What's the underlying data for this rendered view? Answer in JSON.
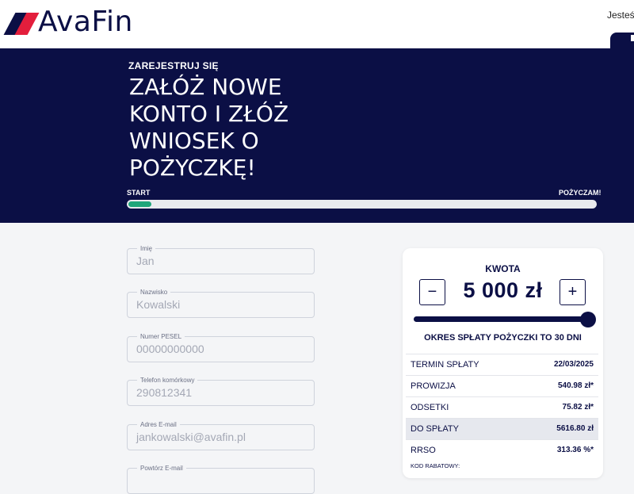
{
  "header": {
    "brand": "AvaFin",
    "account_text": "Jesteś"
  },
  "hero": {
    "subtitle": "ZAREJESTRUJ SIĘ",
    "title": "ZAŁÓŻ NOWE KONTO I ZŁÓŻ WNIOSEK O POŻYCZKĘ!",
    "progress_start": "START",
    "progress_end": "POŻYCZAM!",
    "progress_fraction": 0.05
  },
  "form": {
    "fields": [
      {
        "label": "Imię",
        "value": "Jan"
      },
      {
        "label": "Nazwisko",
        "value": "Kowalski"
      },
      {
        "label": "Numer PESEL",
        "value": "00000000000"
      },
      {
        "label": "Telefon komórkowy",
        "value": "290812341"
      },
      {
        "label": "Adres E-mail",
        "value": "jankowalski@avafin.pl"
      },
      {
        "label": "Powtórz E-mail",
        "value": ""
      }
    ]
  },
  "calculator": {
    "amount_label": "KWOTA",
    "minus": "−",
    "plus": "+",
    "amount": "5 000 zł",
    "slider_fraction": 1.0,
    "period": "OKRES SPŁATY POŻYCZKI TO 30 DNI",
    "rows": [
      {
        "key": "TERMIN SPŁATY",
        "value": "22/03/2025"
      },
      {
        "key": "PROWIZJA",
        "value": "540.98 zł*"
      },
      {
        "key": "ODSETKI",
        "value": "75.82 zł*"
      },
      {
        "key": "DO SPŁATY",
        "value": "5616.80 zł"
      },
      {
        "key": "RRSO",
        "value": "313.36 %*"
      }
    ],
    "coupon_label": "KOD RABATOWY:"
  },
  "colors": {
    "navy": "#0b0f45",
    "red": "#e31e3c",
    "green": "#1fa67a"
  }
}
